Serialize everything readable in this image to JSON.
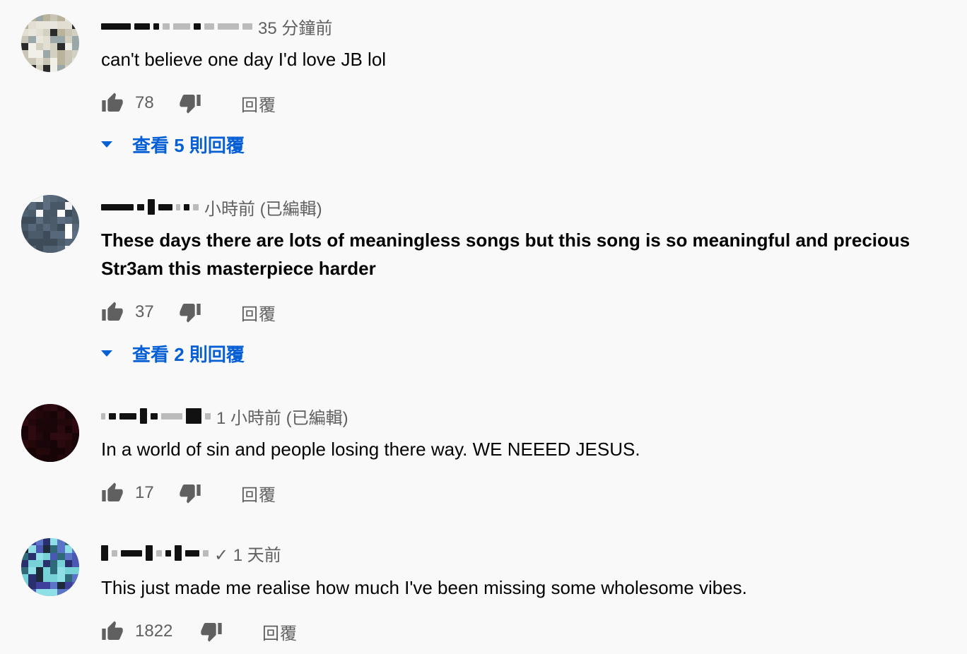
{
  "comments": [
    {
      "time": "35 分鐘前",
      "text": "can't believe one day I'd love JB lol",
      "likes": "78",
      "reply_label": "回覆",
      "view_replies": "查看 5 則回覆"
    },
    {
      "time": "小時前 (已編輯)",
      "text_line1": "These days there are lots of meaningless songs but this song is so meaningful and precious",
      "text_line2": "Str3am this masterpiece harder",
      "likes": "37",
      "reply_label": "回覆",
      "view_replies": "查看 2 則回覆"
    },
    {
      "time": "1 小時前 (已編輯)",
      "text": "In a world of sin and people losing there way. WE NEEED JESUS.",
      "likes": "17",
      "reply_label": "回覆"
    },
    {
      "time": "✓ 1 天前",
      "text": "This just made me realise how much I've been missing some wholesome vibes.",
      "likes": "1822",
      "reply_label": "回覆"
    }
  ],
  "icons": {
    "like": "thumb-up-icon",
    "dislike": "thumb-down-icon",
    "expand": "caret-down-icon"
  },
  "colors": {
    "link": "#065fd4",
    "secondary_text": "#606060",
    "background": "#f9f9f9"
  }
}
